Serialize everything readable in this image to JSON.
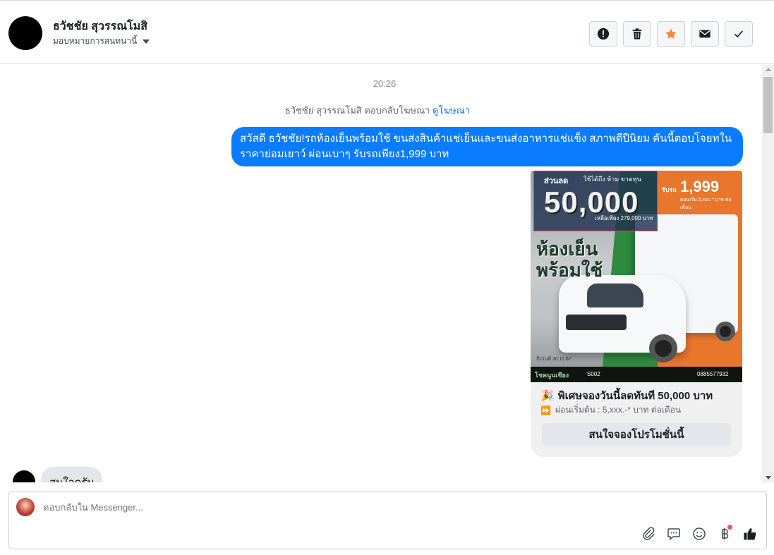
{
  "header": {
    "contact_name": "ธวัชชัย สุวรรณโมสิ",
    "assign_label": "มอบหมายการสนทนานี้",
    "actions": [
      {
        "name": "spam",
        "icon": "alert-circle-icon"
      },
      {
        "name": "delete",
        "icon": "trash-icon"
      },
      {
        "name": "star",
        "icon": "star-icon",
        "color": "#f28b3c"
      },
      {
        "name": "mark-unread",
        "icon": "envelope-icon"
      },
      {
        "name": "done",
        "icon": "check-icon"
      }
    ]
  },
  "conversation": {
    "timestamp": "20:26",
    "reply_note_prefix": "ธวัชชัย สุวรรณโมสิ ตอบกลับโฆษณา",
    "reply_note_link": "ดูโฆษณา",
    "outgoing_message": "สวัสดี ธวัชชัย!รถห้องเย็นพร้อมใช้ ขนส่งสินค้าแช่เย็นและขนส่งอาหารแช่แข็ง สภาพดีปีนิยม คันนี้ตอบโจยทในราคาย่อมเยาว์ ผ่อนเบาๆ รับรถเพียง1,999 บาท",
    "outgoing_color": "#0a7cff",
    "card": {
      "image": {
        "promo_tag": "ส่วนลด",
        "promo_small": "ใช้ได้ถึง ห้าม ขาดทุน",
        "promo_amount": "50,000",
        "promo_remaining": "เหลือเพียง 279,000 บาท",
        "price_label": "รับรถ",
        "price_amount": "1,999",
        "price_sub": "ผ่อนเริ่ม 5,xxx.* บาท ต่อเดือน",
        "headline_line1": "ห้องเย็น",
        "headline_line2": "พร้อมใช้",
        "date_text": "ถึงวันที่ 30.11.67",
        "footer_brand": "โชคนูนเชียง",
        "footer_code": "S002",
        "footer_phone": "0885577932"
      },
      "title_icon": "🎉",
      "title": "พิเศษจองวันนี้ลดทันที 50,000 บาท",
      "subtitle_icon": "⏩",
      "subtitle": "ผ่อนเริ่มต้น : 5,xxx.-* บาท ต่อเดือน",
      "button_label": "สนใจจองโปรโมชั่นนี้"
    },
    "incoming_message": "สนใจครับ"
  },
  "composer": {
    "placeholder": "ตอบกลับใน Messenger...",
    "tools": [
      "paperclip-icon",
      "speech-bubble-icon",
      "emoji-icon",
      "baht-icon",
      "thumbs-up-icon"
    ]
  }
}
